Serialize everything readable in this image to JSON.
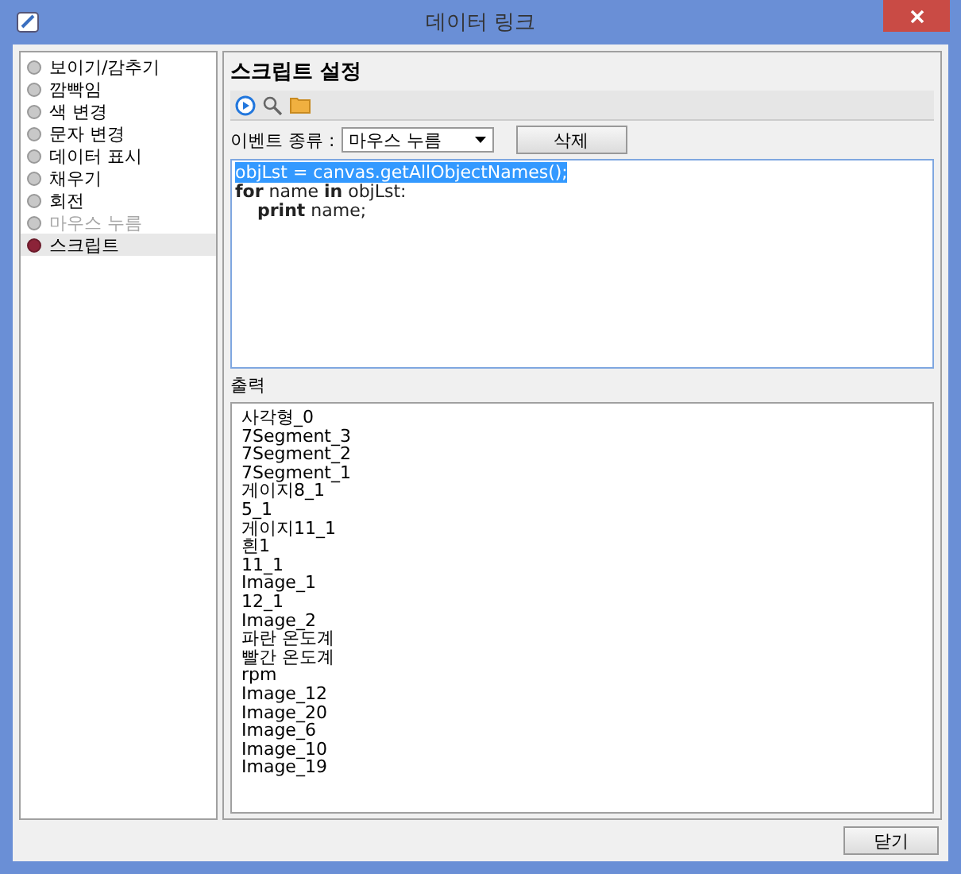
{
  "window": {
    "title": "데이터 링크"
  },
  "sidebar": {
    "items": [
      {
        "label": "보이기/감추기",
        "selected": false,
        "disabled": false
      },
      {
        "label": "깜빡임",
        "selected": false,
        "disabled": false
      },
      {
        "label": "색 변경",
        "selected": false,
        "disabled": false
      },
      {
        "label": "문자 변경",
        "selected": false,
        "disabled": false
      },
      {
        "label": "데이터 표시",
        "selected": false,
        "disabled": false
      },
      {
        "label": "채우기",
        "selected": false,
        "disabled": false
      },
      {
        "label": "회전",
        "selected": false,
        "disabled": false
      },
      {
        "label": "마우스 누름",
        "selected": false,
        "disabled": true
      },
      {
        "label": "스크립트",
        "selected": true,
        "disabled": false
      }
    ]
  },
  "panel": {
    "title": "스크립트 설정",
    "event_label": "이벤트 종류 :",
    "event_value": "마우스 누름",
    "delete_button": "삭제",
    "code_lines": [
      {
        "text": "objLst = canvas.getAllObjectNames();",
        "selected": true
      },
      {
        "text": "**for** name **in** objLst:",
        "selected": false
      },
      {
        "text": "\t**print** name;",
        "selected": false
      }
    ],
    "output_label": "출력",
    "output_lines": [
      "사각형_0",
      "7Segment_3",
      "7Segment_2",
      "7Segment_1",
      "게이지8_1",
      "5_1",
      "게이지11_1",
      "흰1",
      "11_1",
      "Image_1",
      "12_1",
      "Image_2",
      "파란 온도계",
      "빨간 온도계",
      "rpm",
      "Image_12",
      "Image_20",
      "Image_6",
      "Image_10",
      "Image_19"
    ]
  },
  "close_button": "닫기"
}
